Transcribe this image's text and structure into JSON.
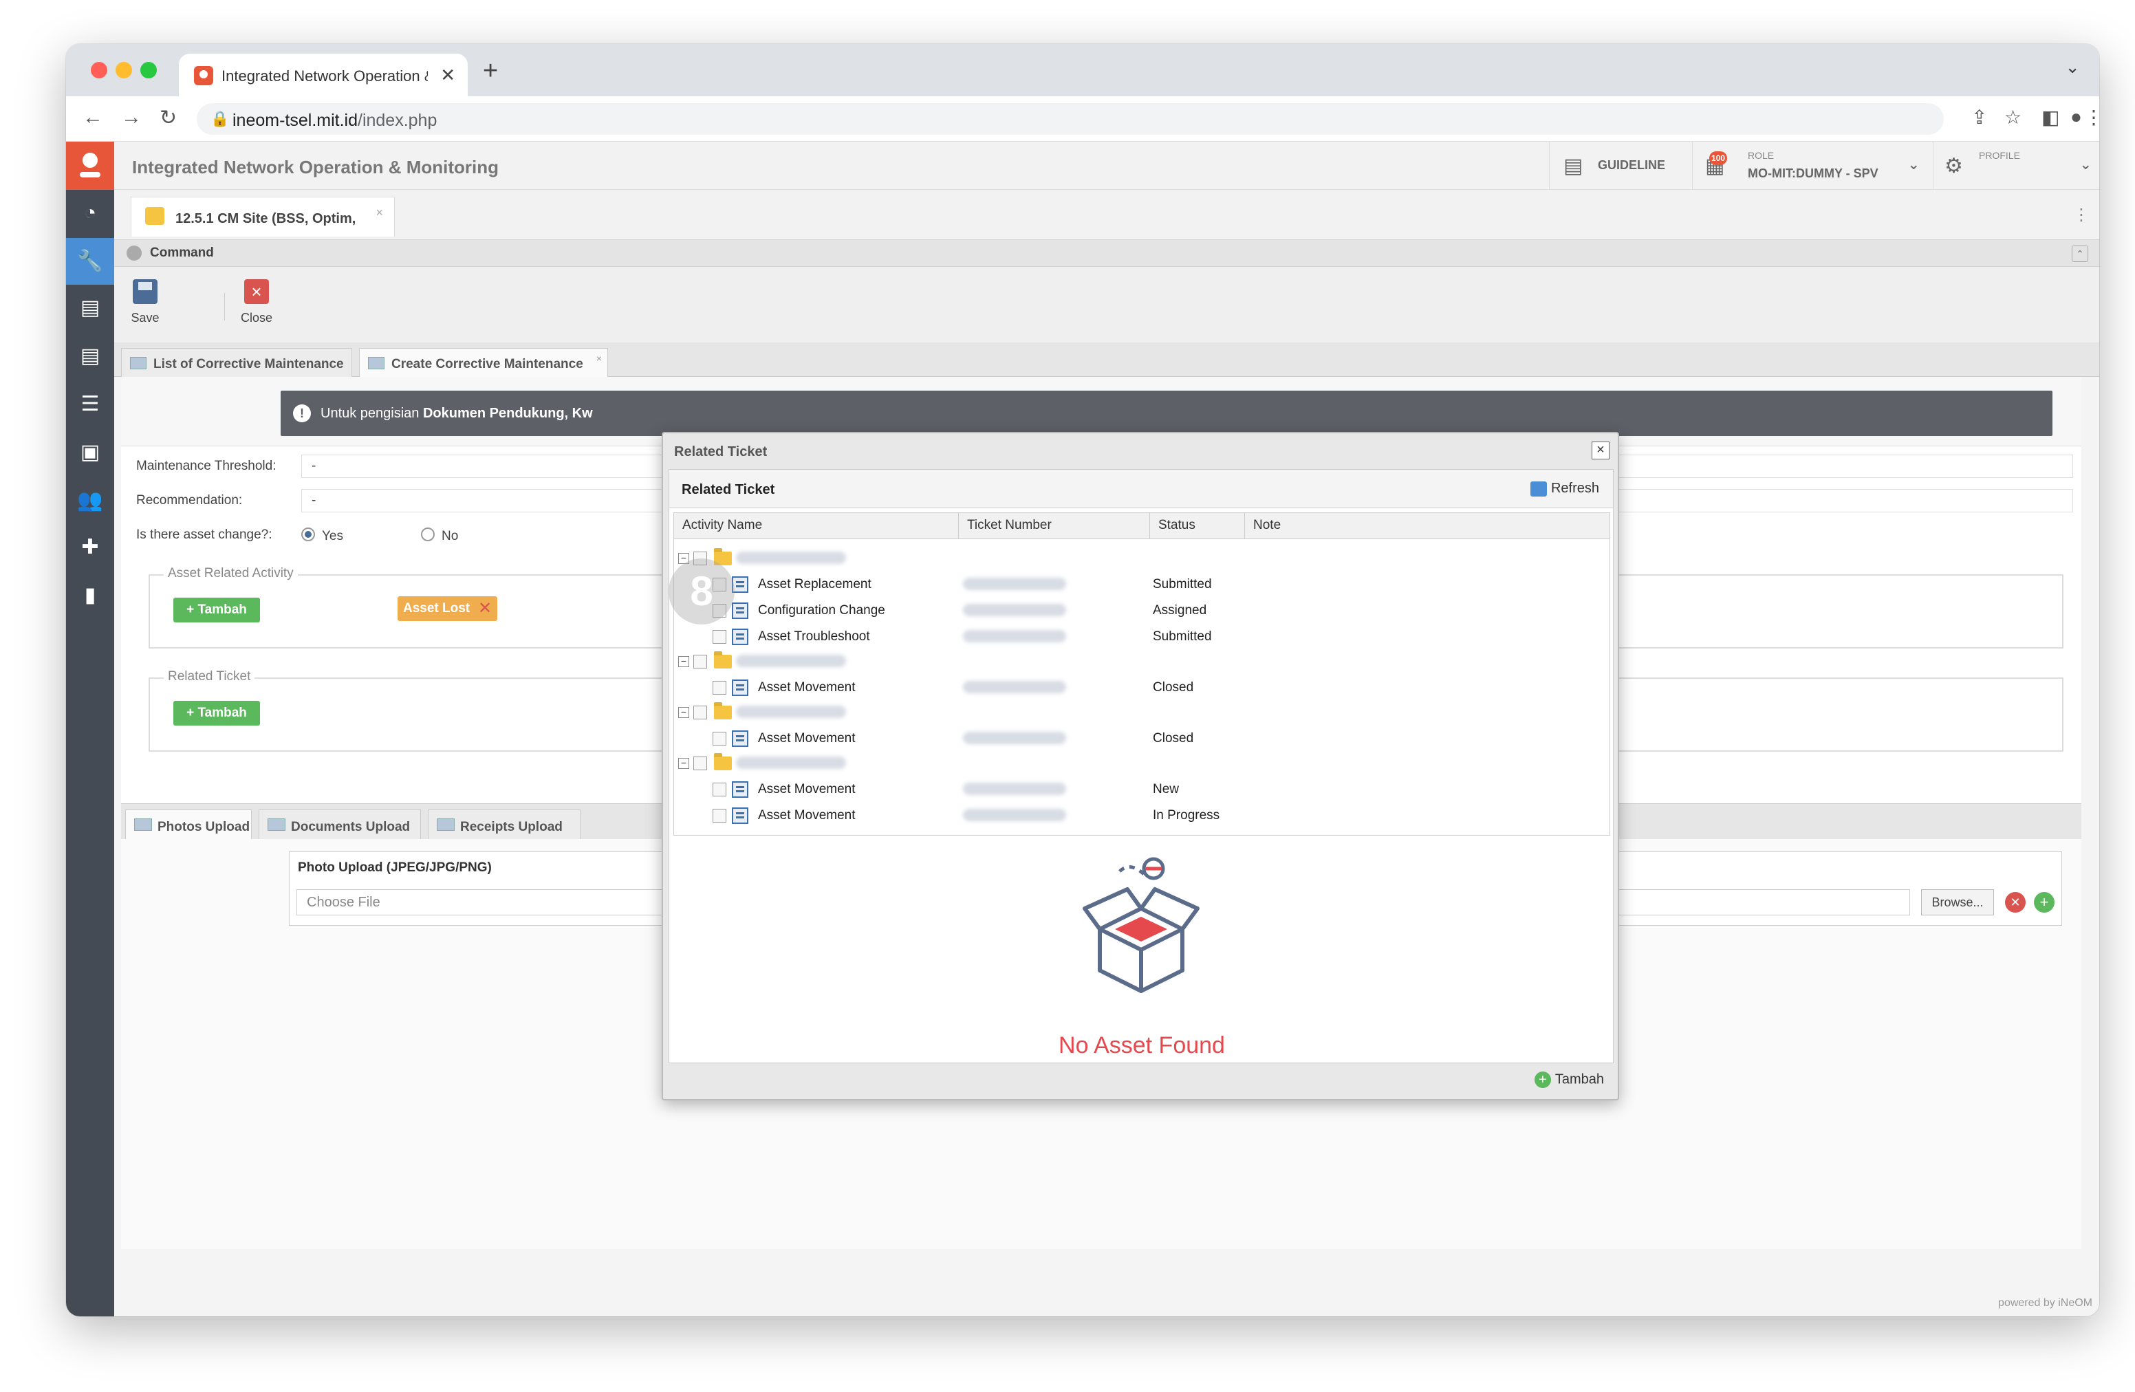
{
  "browser": {
    "tab_title": "Integrated Network Operation & Monitoring",
    "url_host": "ineom-tsel.mit.id",
    "url_path": "/index.php"
  },
  "header": {
    "app_title": "Integrated Network Operation & Monitoring",
    "guideline_label": "GUIDELINE",
    "role_caption": "ROLE",
    "role_value": "MO-MIT:DUMMY - SPV",
    "role_badge": "100",
    "profile_caption": "PROFILE"
  },
  "module_tab": {
    "label": "12.5.1 CM Site (BSS, Optim,"
  },
  "command": {
    "label": "Command",
    "save_label": "Save",
    "close_label": "Close"
  },
  "inner_tabs": [
    {
      "label": "List of Corrective Maintenance"
    },
    {
      "label": "Create Corrective Maintenance"
    }
  ],
  "alert": {
    "prefix": "Untuk pengisian ",
    "bold": "Dokumen Pendukung, Kw"
  },
  "form": {
    "threshold_label": "Maintenance Threshold:",
    "threshold_value": "-",
    "recommendation_label": "Recommendation:",
    "recommendation_value": "-",
    "asset_change_label": "Is there asset change?:",
    "yes_label": "Yes",
    "no_label": "No",
    "asset_activity_legend": "Asset Related Activity",
    "related_ticket_legend": "Related Ticket",
    "tambah_label": "Tambah",
    "asset_lost_chip": "Asset Lost"
  },
  "upload": {
    "tabs": [
      {
        "label": "Photos Upload"
      },
      {
        "label": "Documents Upload"
      },
      {
        "label": "Receipts Upload"
      }
    ],
    "photo_title": "Photo Upload (JPEG/JPG/PNG)",
    "choose_placeholder": "Choose File",
    "browse_label": "Browse..."
  },
  "footer": {
    "powered": "powered by iNeOM"
  },
  "modal": {
    "title": "Related Ticket",
    "panel_title": "Related Ticket",
    "refresh_label": "Refresh",
    "columns": [
      "Activity Name",
      "Ticket Number",
      "Status",
      "Note"
    ],
    "rows": [
      {
        "name": "Asset Replacement",
        "status": "Submitted"
      },
      {
        "name": "Configuration Change",
        "status": "Assigned"
      },
      {
        "name": "Asset Troubleshoot",
        "status": "Submitted"
      },
      {
        "name": "Asset Movement",
        "status": "Closed"
      },
      {
        "name": "Asset Movement",
        "status": "Closed"
      },
      {
        "name": "Asset Movement",
        "status": "New"
      },
      {
        "name": "Asset Movement",
        "status": "In Progress"
      }
    ],
    "step_number": "8",
    "empty_message": "No Asset Found",
    "tambah_label": "Tambah"
  }
}
